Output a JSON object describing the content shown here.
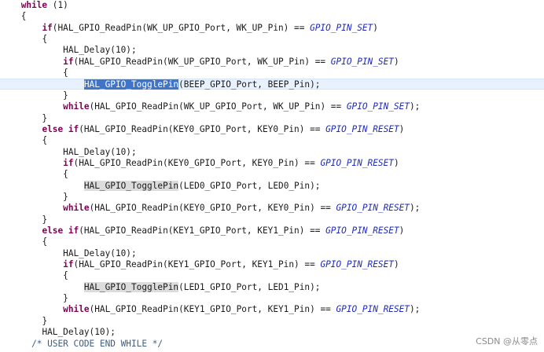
{
  "lines": [
    {
      "indent": 4,
      "parts": [
        {
          "t": "while",
          "c": "kw"
        },
        {
          "t": " (1)"
        }
      ]
    },
    {
      "indent": 4,
      "parts": [
        {
          "t": "{"
        }
      ]
    },
    {
      "indent": 8,
      "parts": [
        {
          "t": "if",
          "c": "kw"
        },
        {
          "t": "(HAL_GPIO_ReadPin(WK_UP_GPIO_Port, WK_UP_Pin) == "
        },
        {
          "t": "GPIO_PIN_SET",
          "c": "macro"
        },
        {
          "t": ")"
        }
      ]
    },
    {
      "indent": 8,
      "parts": [
        {
          "t": "{"
        }
      ]
    },
    {
      "indent": 12,
      "parts": [
        {
          "t": "HAL_Delay(10);"
        }
      ]
    },
    {
      "indent": 12,
      "parts": [
        {
          "t": "if",
          "c": "kw"
        },
        {
          "t": "(HAL_GPIO_ReadPin(WK_UP_GPIO_Port, WK_UP_Pin) == "
        },
        {
          "t": "GPIO_PIN_SET",
          "c": "macro"
        },
        {
          "t": ")"
        }
      ]
    },
    {
      "indent": 12,
      "parts": [
        {
          "t": "{"
        }
      ]
    },
    {
      "indent": 16,
      "current": true,
      "parts": [
        {
          "t": "HAL_GPIO_TogglePin",
          "c": "hl-sel"
        },
        {
          "t": "(BEEP_GPIO_Port, BEEP_Pin);"
        }
      ]
    },
    {
      "indent": 12,
      "parts": [
        {
          "t": "}"
        }
      ]
    },
    {
      "indent": 12,
      "parts": [
        {
          "t": "while",
          "c": "kw"
        },
        {
          "t": "(HAL_GPIO_ReadPin(WK_UP_GPIO_Port, WK_UP_Pin) == "
        },
        {
          "t": "GPIO_PIN_SET",
          "c": "macro"
        },
        {
          "t": ");"
        }
      ]
    },
    {
      "indent": 8,
      "parts": [
        {
          "t": "}"
        }
      ]
    },
    {
      "indent": 8,
      "parts": [
        {
          "t": "else if",
          "c": "kw"
        },
        {
          "t": "(HAL_GPIO_ReadPin(KEY0_GPIO_Port, KEY0_Pin) == "
        },
        {
          "t": "GPIO_PIN_RESET",
          "c": "macro"
        },
        {
          "t": ")"
        }
      ]
    },
    {
      "indent": 8,
      "parts": [
        {
          "t": "{"
        }
      ]
    },
    {
      "indent": 12,
      "parts": [
        {
          "t": "HAL_Delay(10);"
        }
      ]
    },
    {
      "indent": 12,
      "parts": [
        {
          "t": "if",
          "c": "kw"
        },
        {
          "t": "(HAL_GPIO_ReadPin(KEY0_GPIO_Port, KEY0_Pin) == "
        },
        {
          "t": "GPIO_PIN_RESET",
          "c": "macro"
        },
        {
          "t": ")"
        }
      ]
    },
    {
      "indent": 12,
      "parts": [
        {
          "t": "{"
        }
      ]
    },
    {
      "indent": 16,
      "parts": [
        {
          "t": "HAL_GPIO_TogglePin",
          "c": "hl-occ"
        },
        {
          "t": "(LED0_GPIO_Port, LED0_Pin);"
        }
      ]
    },
    {
      "indent": 12,
      "parts": [
        {
          "t": "}"
        }
      ]
    },
    {
      "indent": 12,
      "parts": [
        {
          "t": "while",
          "c": "kw"
        },
        {
          "t": "(HAL_GPIO_ReadPin(KEY0_GPIO_Port, KEY0_Pin) == "
        },
        {
          "t": "GPIO_PIN_RESET",
          "c": "macro"
        },
        {
          "t": ");"
        }
      ]
    },
    {
      "indent": 8,
      "parts": [
        {
          "t": "}"
        }
      ]
    },
    {
      "indent": 8,
      "parts": [
        {
          "t": "else if",
          "c": "kw"
        },
        {
          "t": "(HAL_GPIO_ReadPin(KEY1_GPIO_Port, KEY1_Pin) == "
        },
        {
          "t": "GPIO_PIN_RESET",
          "c": "macro"
        },
        {
          "t": ")"
        }
      ]
    },
    {
      "indent": 8,
      "parts": [
        {
          "t": "{"
        }
      ]
    },
    {
      "indent": 12,
      "parts": [
        {
          "t": "HAL_Delay(10);"
        }
      ]
    },
    {
      "indent": 12,
      "parts": [
        {
          "t": "if",
          "c": "kw"
        },
        {
          "t": "(HAL_GPIO_ReadPin(KEY1_GPIO_Port, KEY1_Pin) == "
        },
        {
          "t": "GPIO_PIN_RESET",
          "c": "macro"
        },
        {
          "t": ")"
        }
      ]
    },
    {
      "indent": 12,
      "parts": [
        {
          "t": "{"
        }
      ]
    },
    {
      "indent": 16,
      "parts": [
        {
          "t": "HAL_GPIO_TogglePin",
          "c": "hl-occ"
        },
        {
          "t": "(LED1_GPIO_Port, LED1_Pin);"
        }
      ]
    },
    {
      "indent": 12,
      "parts": [
        {
          "t": "}"
        }
      ]
    },
    {
      "indent": 12,
      "parts": [
        {
          "t": "while",
          "c": "kw"
        },
        {
          "t": "(HAL_GPIO_ReadPin(KEY1_GPIO_Port, KEY1_Pin) == "
        },
        {
          "t": "GPIO_PIN_RESET",
          "c": "macro"
        },
        {
          "t": ");"
        }
      ]
    },
    {
      "indent": 8,
      "parts": [
        {
          "t": "}"
        }
      ]
    },
    {
      "indent": 8,
      "parts": [
        {
          "t": "HAL_Delay(10);"
        }
      ]
    },
    {
      "indent": 6,
      "parts": [
        {
          "t": "/* USER CODE END WHILE */",
          "c": "cmt"
        }
      ]
    }
  ],
  "watermark": "CSDN @从零点",
  "colors": {
    "keyword": "#7f0055",
    "macro": "#1f2bb8",
    "comment": "#3f5f7f",
    "selection": "#3f74c9",
    "occurrence": "#dcdcdc",
    "current_line": "#e8f2fe"
  }
}
